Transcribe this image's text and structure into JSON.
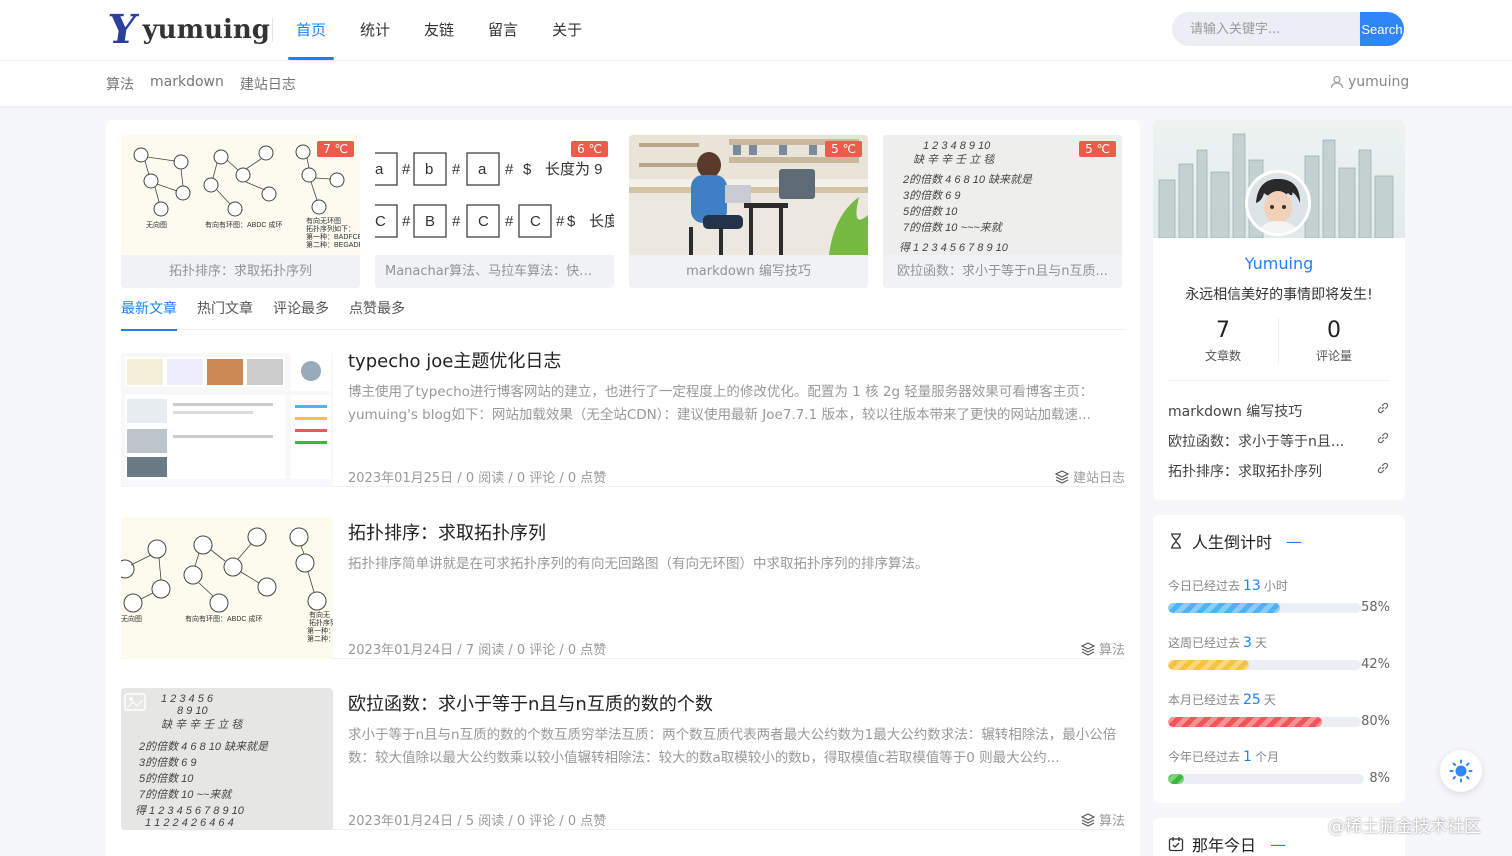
{
  "header": {
    "logo_text": "yumuing",
    "nav": [
      "首页",
      "统计",
      "友链",
      "留言",
      "关于"
    ],
    "search_placeholder": "请输入关键字...",
    "search_button": "Search"
  },
  "subnav": [
    "算法",
    "markdown",
    "建站日志"
  ],
  "user_name": "yumuing",
  "featured": [
    {
      "title": "拓扑排序：求取拓扑序列",
      "temp": "7 ℃"
    },
    {
      "title": "Manachar算法、马拉车算法：快速...",
      "temp": "6 ℃"
    },
    {
      "title": "markdown 编写技巧",
      "temp": "5 ℃"
    },
    {
      "title": "欧拉函数：求小于等于n且与n互质...",
      "temp": "5 ℃"
    }
  ],
  "tabs": [
    "最新文章",
    "热门文章",
    "评论最多",
    "点赞最多"
  ],
  "posts": [
    {
      "title": "typecho joe主题优化日志",
      "excerpt": "博主使用了typecho进行博客网站的建立，也进行了一定程度上的修改优化。配置为 1 核 2g 轻量服务器效果可看博客主页：yumuing's blog如下：网站加载效果（无全站CDN）：建议使用最新 Joe7.7.1 版本，较以往版本带来了更快的网站加载速...",
      "meta": "2023年01月25日 / 0 阅读 / 0 评论 / 0 点赞",
      "category": "建站日志"
    },
    {
      "title": "拓扑排序：求取拓扑序列",
      "excerpt": "拓扑排序简单讲就是在可求拓扑序列的有向无回路图（有向无环图）中求取拓扑序列的排序算法。",
      "meta": "2023年01月24日 / 7 阅读 / 0 评论 / 0 点赞",
      "category": "算法"
    },
    {
      "title": "欧拉函数：求小于等于n且与n互质的数的个数",
      "excerpt": "求小于等于n且与n互质的数的个数互质穷举法互质：两个数互质代表两者最大公约数为1最大公约数求法：辗转相除法，最小公倍数：较大值除以最大公约数乘以较小值辗转相除法：较大的数a取模较小的数b，得取模值c若取模值等于0 则最大公约...",
      "meta": "2023年01月24日 / 5 阅读 / 0 评论 / 0 点赞",
      "category": "算法"
    }
  ],
  "sidebar": {
    "name": "Yumuing",
    "motto": "永远相信美好的事情即将发生!",
    "articles_count": "7",
    "articles_label": "文章数",
    "comments_count": "0",
    "comments_label": "评论量",
    "links": [
      "markdown 编写技巧",
      "欧拉函数：求小于等于n且...",
      "拓扑排序：求取拓扑序列"
    ],
    "countdown_title": "人生倒计时",
    "countdown": [
      {
        "prefix": "今日已经过去",
        "value": "13",
        "unit": "小时",
        "percent": "58%",
        "color": "#4fb2f5"
      },
      {
        "prefix": "这周已经过去",
        "value": "3",
        "unit": "天",
        "percent": "42%",
        "color": "#f5c342"
      },
      {
        "prefix": "本月已经过去",
        "value": "25",
        "unit": "天",
        "percent": "80%",
        "color": "#f4545a"
      },
      {
        "prefix": "今年已经过去",
        "value": "1",
        "unit": "个月",
        "percent": "8%",
        "color": "#3cb73c"
      }
    ],
    "history_title": "那年今日"
  },
  "watermark": "@稀土掘金技术社区"
}
